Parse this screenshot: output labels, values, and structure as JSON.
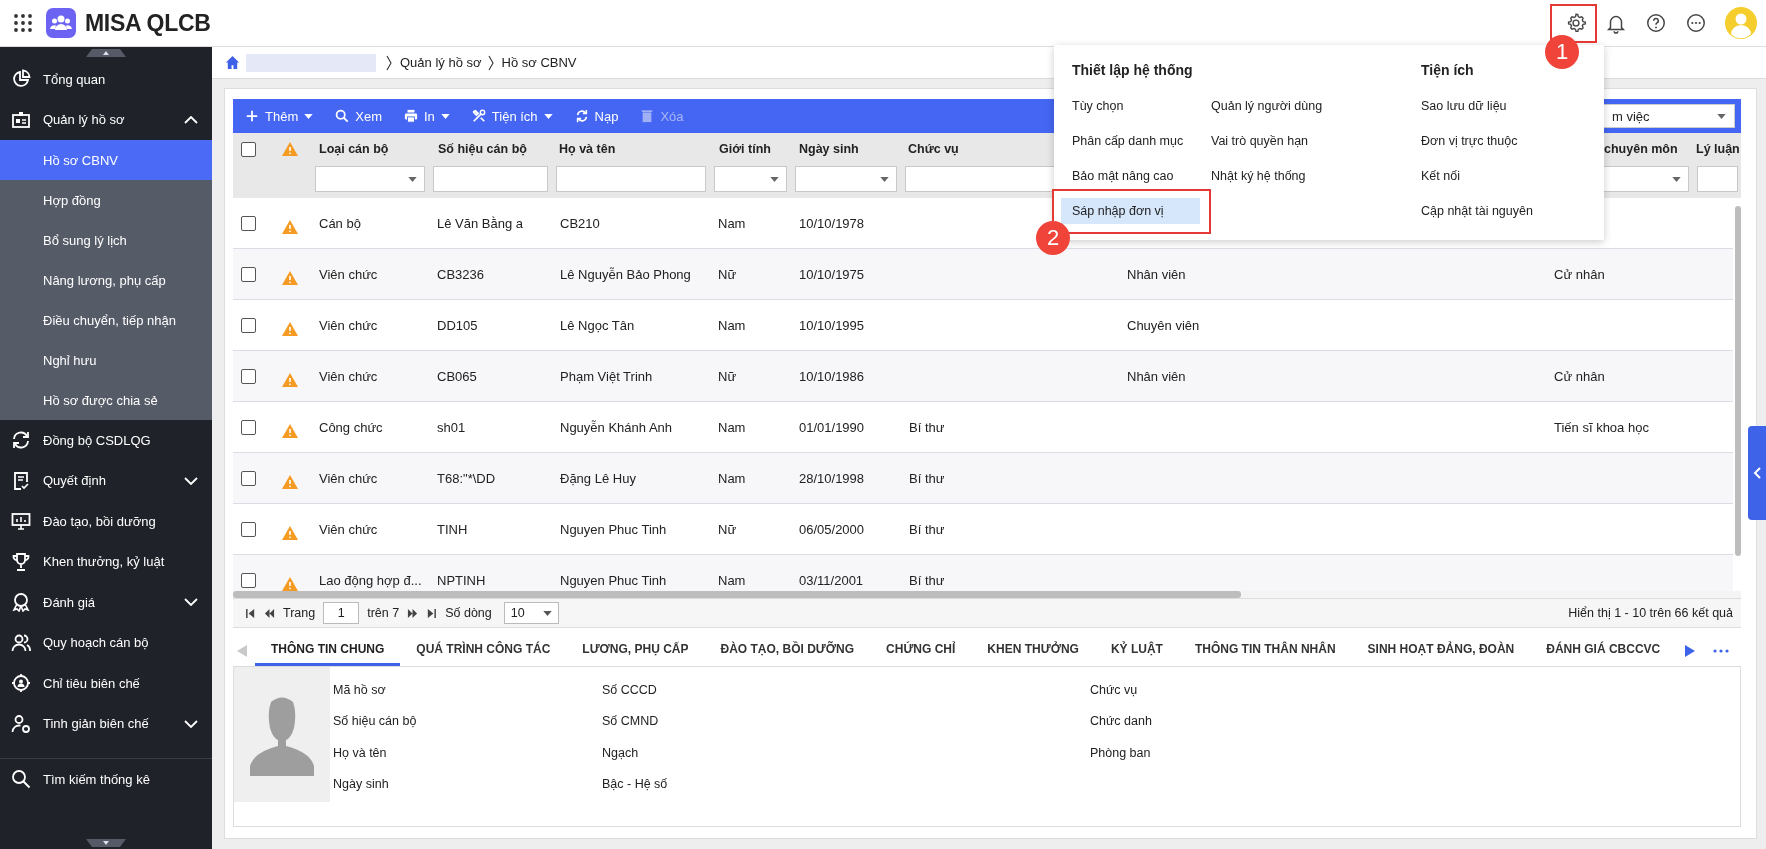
{
  "app": {
    "name": "MISA QLCB"
  },
  "annotations": [
    {
      "label": "1"
    },
    {
      "label": "2"
    }
  ],
  "sidebar": {
    "items": [
      {
        "label": "Tổng quan",
        "selected": false
      },
      {
        "label": "Quản lý hồ sơ",
        "selected": false,
        "expanded": true,
        "children": [
          {
            "label": "Hồ sơ CBNV",
            "selected": true
          },
          {
            "label": "Hợp đồng",
            "selected": false
          },
          {
            "label": "Bổ sung lý lịch",
            "selected": false
          },
          {
            "label": "Nâng lương, phụ cấp",
            "selected": false
          },
          {
            "label": "Điều chuyển, tiếp nhận",
            "selected": false
          },
          {
            "label": "Nghỉ hưu",
            "selected": false
          },
          {
            "label": "Hồ sơ được chia sẻ",
            "selected": false
          }
        ]
      },
      {
        "label": "Đồng bộ CSDLQG",
        "selected": false
      },
      {
        "label": "Quyết định",
        "selected": false,
        "expanded": false
      },
      {
        "label": "Đào tạo, bồi dưỡng",
        "selected": false
      },
      {
        "label": "Khen thưởng, kỷ luật",
        "selected": false
      },
      {
        "label": "Đánh giá",
        "selected": false,
        "expanded": false
      },
      {
        "label": "Quy hoạch cán bộ",
        "selected": false
      },
      {
        "label": "Chỉ tiêu biên chế",
        "selected": false
      },
      {
        "label": "Tinh giản biên chế",
        "selected": false,
        "expanded": false
      }
    ],
    "bottom_items": [
      {
        "label": "Tìm kiếm thống kê",
        "selected": false
      }
    ]
  },
  "breadcrumb": [
    "Quản lý hồ sơ",
    "Hồ sơ CBNV"
  ],
  "toolbar": {
    "buttons": [
      {
        "label": "Thêm",
        "dropdown": true,
        "disabled": false
      },
      {
        "label": "Xem",
        "dropdown": false,
        "disabled": false
      },
      {
        "label": "In",
        "dropdown": true,
        "disabled": false
      },
      {
        "label": "Tiện ích",
        "dropdown": true,
        "disabled": false
      },
      {
        "label": "Nạp",
        "dropdown": false,
        "disabled": false
      },
      {
        "label": "Xóa",
        "dropdown": false,
        "disabled": true
      }
    ],
    "view_select": {
      "value": "m việc"
    }
  },
  "table": {
    "select_all": {
      "checked": false
    },
    "columns": [
      {
        "kind": "text",
        "label": "Loại cán bộ",
        "filter_dropdown": true
      },
      {
        "kind": "text",
        "label": "Số hiệu cán bộ",
        "filter_dropdown": false
      },
      {
        "kind": "text",
        "label": "Họ và tên",
        "filter_dropdown": false
      },
      {
        "kind": "text",
        "label": "Giới tính",
        "filter_dropdown": true
      },
      {
        "kind": "text",
        "label": "Ngày sinh",
        "filter_dropdown": true
      },
      {
        "kind": "text",
        "label": "Chức vụ",
        "filter_dropdown": false
      },
      {
        "kind": "text"
      },
      {
        "kind": "text",
        "label": "chuyên môn",
        "filter_dropdown": true
      },
      {
        "kind": "text",
        "label": "Lý luận",
        "filter_dropdown": false
      }
    ],
    "rows": [
      {
        "checked": false,
        "warning": true,
        "cells": [
          "Cán bộ",
          "Lê Văn Bằng a",
          "CB210",
          "Nam",
          "10/10/1978"
        ]
      },
      {
        "checked": false,
        "warning": true,
        "cells": [
          "Viên chức",
          "CB3236",
          "Lê Nguyễn Bảo Phong",
          "Nữ",
          "10/10/1975",
          null,
          "Nhân viên",
          "Cử nhân"
        ]
      },
      {
        "checked": false,
        "warning": true,
        "cells": [
          "Viên chức",
          "DD105",
          "Lê Ngọc Tân",
          "Nam",
          "10/10/1995",
          null,
          "Chuyên viên"
        ]
      },
      {
        "checked": false,
        "warning": true,
        "cells": [
          "Viên chức",
          "CB065",
          "Phạm Việt Trinh",
          "Nữ",
          "10/10/1986",
          null,
          "Nhân viên",
          "Cử nhân"
        ]
      },
      {
        "checked": false,
        "warning": true,
        "cells": [
          "Công chức",
          "sh01",
          "Nguyễn Khánh Anh",
          "Nam",
          "01/01/1990",
          "Bí thư",
          null,
          "Tiến sĩ khoa học"
        ]
      },
      {
        "checked": false,
        "warning": true,
        "cells": [
          "Viên chức",
          "T68:\"*\\DD",
          "Đặng Lê Huy",
          "Nam",
          "28/10/1998",
          "Bí thư"
        ]
      },
      {
        "checked": false,
        "warning": true,
        "cells": [
          "Viên chức",
          "TINH",
          "Nguyen Phuc Tinh",
          "Nữ",
          "06/05/2000",
          "Bí thư"
        ]
      },
      {
        "checked": false,
        "warning": true,
        "cells": [
          "Lao động hợp đ...",
          "NPTINH",
          "Nguyen Phuc Tinh",
          "Nam",
          "03/11/2001",
          "Bí thư"
        ]
      }
    ]
  },
  "pager": {
    "page_label": "Trang",
    "page": "1",
    "of": "trên 7",
    "rows_label": "Số dòng",
    "rows_per_page": "10",
    "summary": "Hiển thị 1 - 10 trên 66 kết quả"
  },
  "detail_tabs": [
    {
      "label": "THÔNG TIN CHUNG",
      "selected": true
    },
    {
      "label": "QUÁ TRÌNH CÔNG TÁC",
      "selected": false
    },
    {
      "label": "LƯƠNG, PHỤ CẤP",
      "selected": false
    },
    {
      "label": "ĐÀO TẠO, BỒI DƯỠNG",
      "selected": false
    },
    {
      "label": "CHỨNG CHỈ",
      "selected": false
    },
    {
      "label": "KHEN THƯỞNG",
      "selected": false
    },
    {
      "label": "KỶ LUẬT",
      "selected": false
    },
    {
      "label": "THÔNG TIN THÂN NHÂN",
      "selected": false
    },
    {
      "label": "SINH HOẠT ĐẢNG, ĐOÀN",
      "selected": false
    },
    {
      "label": "ĐÁNH GIÁ CBCCVC",
      "selected": false
    }
  ],
  "detail": {
    "columns": [
      [
        "Mã hồ sơ",
        "Số hiệu cán bộ",
        "Họ và tên",
        "Ngày sinh"
      ],
      [
        "Số CCCD",
        "Số CMND",
        "Ngạch",
        "Bậc - Hệ số"
      ],
      [
        "Chức vụ",
        "Chức danh",
        "Phòng ban"
      ]
    ]
  },
  "settings_menu": {
    "sections": [
      {
        "title": "Thiết lập hệ thống",
        "columns": [
          [
            {
              "label": "Tùy chọn",
              "selected": false
            },
            {
              "label": "Phân cấp danh mục",
              "selected": false
            },
            {
              "label": "Bảo mật nâng cao",
              "selected": false
            },
            {
              "label": "Sáp nhập đơn vị",
              "selected": true
            }
          ],
          [
            {
              "label": "Quản lý người dùng",
              "selected": false
            },
            {
              "label": "Vai trò quyền hạn",
              "selected": false
            },
            {
              "label": "Nhật ký hệ thống",
              "selected": false
            }
          ]
        ]
      },
      {
        "title": "Tiện ích",
        "columns": [
          [
            {
              "label": "Sao lưu dữ liệu",
              "selected": false
            },
            {
              "label": "Đơn vị trực thuộc",
              "selected": false
            },
            {
              "label": "Kết nối",
              "selected": false
            },
            {
              "label": "Cập nhật tài nguyên",
              "selected": false
            }
          ]
        ]
      }
    ]
  }
}
